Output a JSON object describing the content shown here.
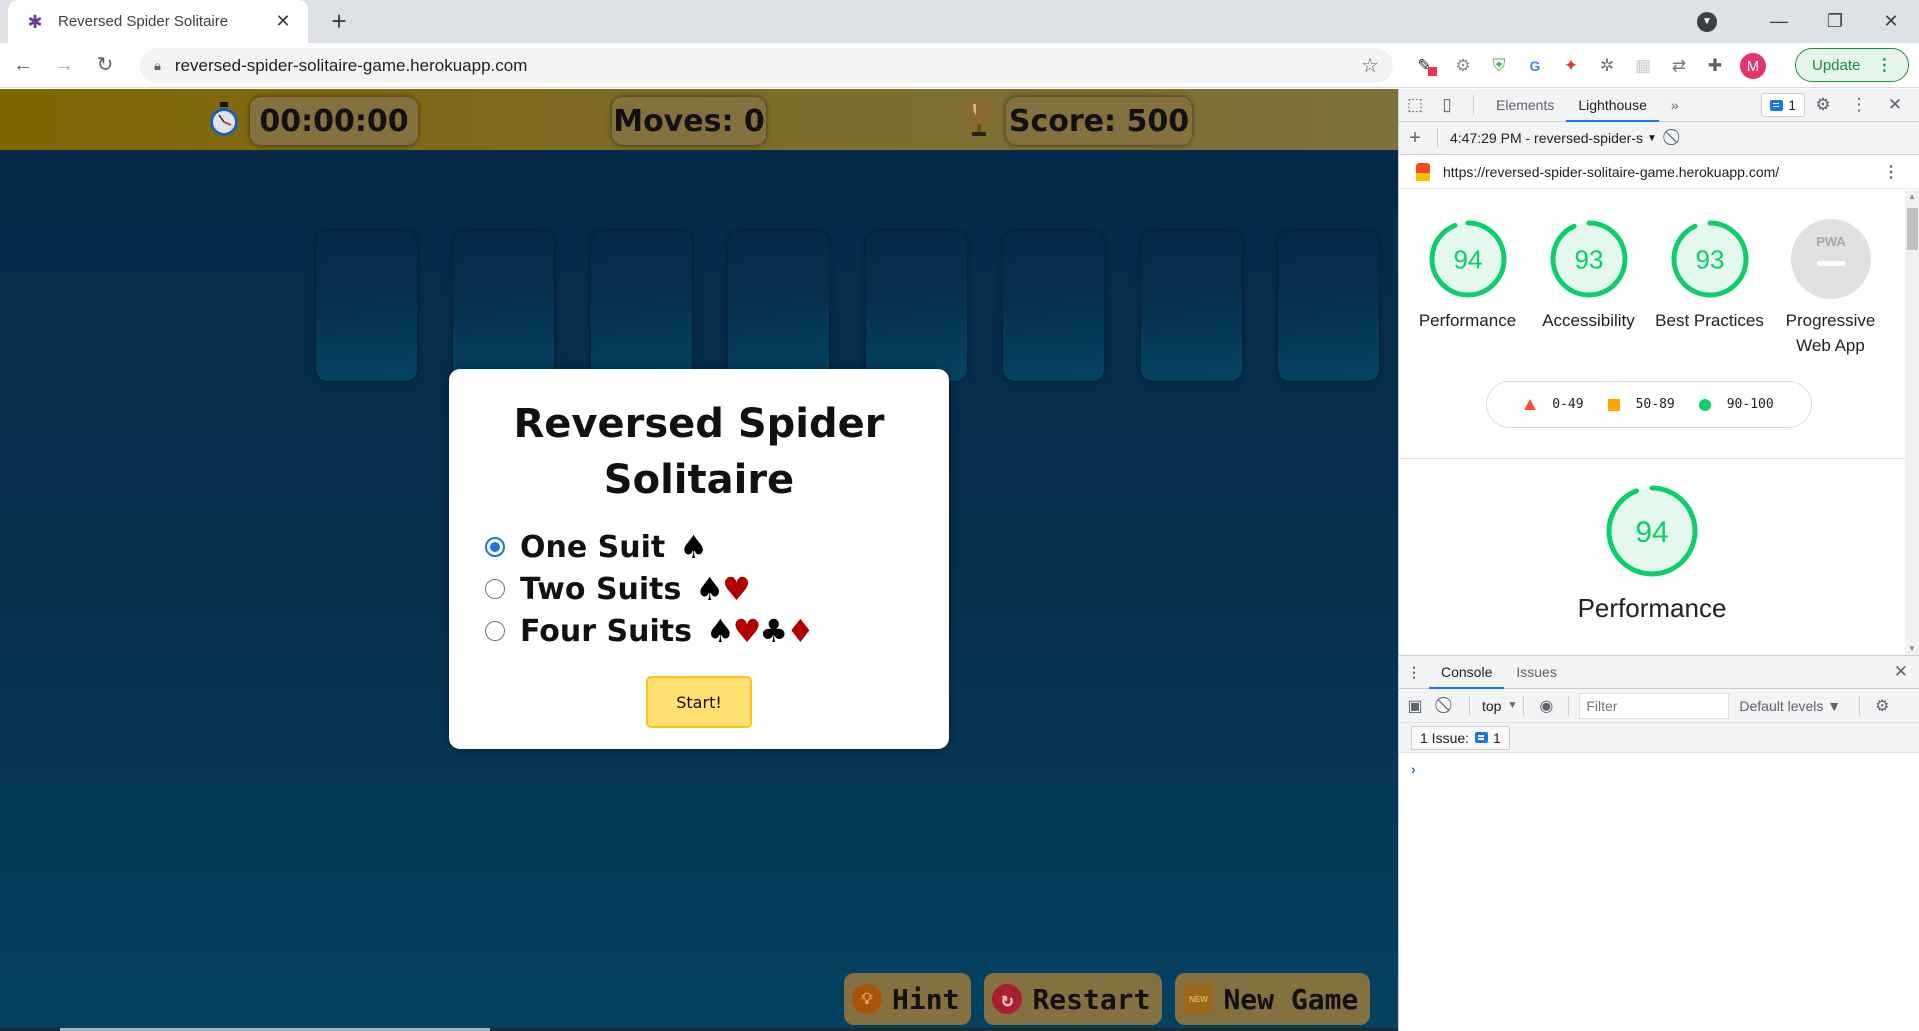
{
  "browser": {
    "tab_title": "Reversed Spider Solitaire",
    "url": "reversed-spider-solitaire-game.herokuapp.com",
    "update_label": "Update",
    "profile_initial": "M",
    "icons": {
      "tab_close": "✕",
      "new_tab": "+",
      "back": "←",
      "forward": "→",
      "reload": "↻",
      "star": "☆",
      "minimize": "—",
      "restore": "❐",
      "close": "✕"
    }
  },
  "game": {
    "timer": "00:00:00",
    "moves": "Moves: 0",
    "score": "Score: 500",
    "slot_count": 8,
    "modal": {
      "title": "Reversed Spider Solitaire",
      "options": [
        {
          "label": "One Suit",
          "suits": [
            "♠"
          ],
          "selected": true
        },
        {
          "label": "Two Suits",
          "suits": [
            "♠",
            "♥"
          ],
          "selected": false
        },
        {
          "label": "Four Suits",
          "suits": [
            "♠",
            "♥",
            "♣",
            "♦"
          ],
          "selected": false
        }
      ],
      "start_label": "Start!"
    },
    "buttons": {
      "hint": "Hint",
      "restart": "Restart",
      "new_game": "New Game",
      "new_badge": "NEW"
    }
  },
  "devtools": {
    "tabs": [
      "Elements",
      "Lighthouse"
    ],
    "active_tab": "Lighthouse",
    "more_tabs": "»",
    "issues_count": "1",
    "report_label": "4:47:29 PM - reversed-spider-s",
    "report_url": "https://reversed-spider-solitaire-game.herokuapp.com/",
    "scores": [
      {
        "label": "Performance",
        "score": 94
      },
      {
        "label": "Accessibility",
        "score": 93
      },
      {
        "label": "Best Practices",
        "score": 93
      },
      {
        "label": "Progressive Web App",
        "score": null,
        "badge": "PWA"
      }
    ],
    "legend": [
      {
        "range": "0-49",
        "shape": "triangle",
        "color": "#ff4e42"
      },
      {
        "range": "50-89",
        "shape": "square",
        "color": "#ffa400"
      },
      {
        "range": "90-100",
        "shape": "circle",
        "color": "#0cce6b"
      }
    ],
    "detail": {
      "label": "Performance",
      "score": 94
    },
    "colors": {
      "pass": "#0cce6b",
      "pass_bg": "#e5f8ed",
      "accent": "#1a73e8"
    },
    "drawer": {
      "tabs": [
        "Console",
        "Issues"
      ],
      "active_tab": "Console",
      "context": "top",
      "filter_placeholder": "Filter",
      "levels": "Default levels",
      "issues_label": "1 Issue:",
      "issues_count": "1",
      "prompt": "›"
    }
  }
}
